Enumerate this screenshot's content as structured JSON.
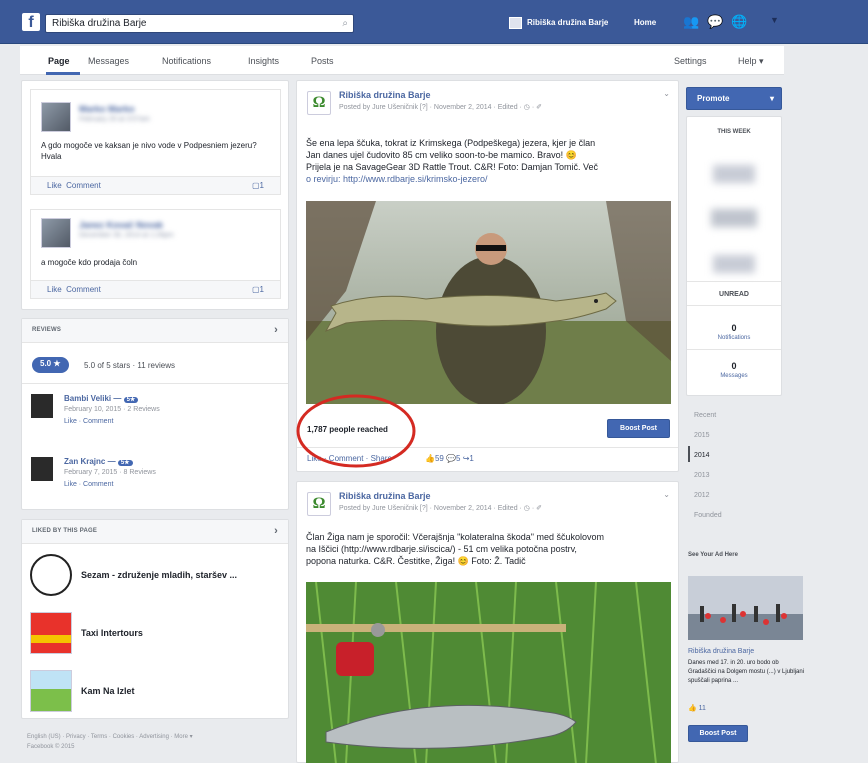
{
  "topbar": {
    "search_value": "Ribiška družina Barje",
    "page_name": "Ribiška družina Barje",
    "home_label": "Home"
  },
  "nav": {
    "tabs": [
      "Page",
      "Messages",
      "Notifications",
      "Insights",
      "Posts"
    ],
    "settings_label": "Settings",
    "help_label": "Help ▾"
  },
  "comments": [
    {
      "name": "Marko Marko",
      "time": "February 20 at 3:57am",
      "text": "A gdo mogoče ve kaksan je nivo vode v Podpesniem jezeru? Hvala",
      "like": "Like",
      "comment": "Comment",
      "count": "1"
    },
    {
      "name": "Janez Kovač Novak",
      "time": "December 30, 2014 at 1:26pm",
      "text": "a mogoče kdo prodaja čoln",
      "like": "Like",
      "comment": "Comment",
      "count": "1"
    }
  ],
  "reviews": {
    "header": "REVIEWS",
    "rating_badge": "5.0 ★",
    "summary": "5.0 of 5 stars · 11 reviews",
    "items": [
      {
        "name": "Bambi Veliki —",
        "badge": "5★",
        "date": "February 10, 2015 · 2 Reviews",
        "actions": "Like · Comment"
      },
      {
        "name": "Zan Krajnc —",
        "badge": "5★",
        "date": "February 7, 2015 · 8 Reviews",
        "actions": "Like · Comment"
      }
    ]
  },
  "liked": {
    "header": "LIKED BY THIS PAGE",
    "items": [
      "Sezam - združenje mladih, staršev ...",
      "Taxi Intertours",
      "Kam Na Izlet"
    ]
  },
  "footer": {
    "line1": "English (US) · Privacy · Terms · Cookies · Advertising · More ▾",
    "line2": "Facebook © 2015"
  },
  "posts": [
    {
      "page": "Ribiška družina Barje",
      "meta": "Posted by Jure Ušeničnik [?] · November 2, 2014 · Edited · ◷ · ✐",
      "text_lines": [
        "Še ena lepa ščuka, tokrat iz Krimskega (Podpeškega) jezera, kjer je član",
        "Jan danes ujel čudovito  85 cm veliko soon-to-be mamico. Bravo! 😊",
        "Prijela je na SavageGear 3D Rattle Trout. C&R! Foto: Damjan Tomič. Več",
        "o revirju: http://www.rdbarje.si/krimsko-jezero/"
      ],
      "reached": "1,787 people reached",
      "boost": "Boost Post",
      "actions": "Like · Comment · Share",
      "reactions": "👍59 💬5 ↪1"
    },
    {
      "page": "Ribiška družina Barje",
      "meta": "Posted by Jure Ušeničnik [?] · November 2, 2014 · Edited · ◷ · ✐",
      "text_lines": [
        "Član Žiga nam je sporočil: Včerajšnja \"kolateralna škoda\" med ščukolovom",
        "na Iščici (http://www.rdbarje.si/iscica/) - 51 cm velika potočna postrv,",
        "popona naturka. C&R. Čestitke, Žiga! 😊 Foto: Ž. Tadič"
      ]
    }
  ],
  "right": {
    "promote": "Promote",
    "this_week": "THIS WEEK",
    "unread": "UNREAD",
    "notif_count": "0",
    "notif_label": "Notifications",
    "msg_count": "0",
    "msg_label": "Messages",
    "years": [
      "Recent",
      "2015",
      "2014",
      "2013",
      "2012",
      "Founded"
    ],
    "ad_heading": "See Your Ad Here",
    "ad_title": "Ribiška družina Barje",
    "ad_text": "Danes med 17. in 20. uro bodo ob Gradaščici na Dolgem mostu (...) v Ljubljani spuščali paprina ...",
    "ad_likes": "👍 11",
    "ad_boost": "Boost Post"
  },
  "colors": {
    "brand": "#3b5998",
    "button": "#4267b2",
    "circle": "#d42a22"
  }
}
